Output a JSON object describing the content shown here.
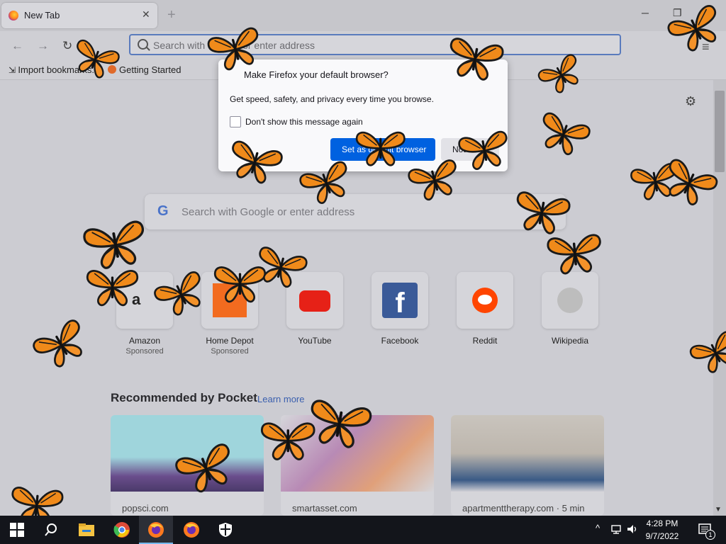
{
  "window": {
    "tab_title": "New Tab",
    "tab_close": "✕",
    "new_tab": "+",
    "minimize": "─",
    "restore": "❐",
    "close": "✕"
  },
  "navbar": {
    "back": "←",
    "forward": "→",
    "reload": "↻",
    "url_placeholder": "Search with Google or enter address",
    "menu": "≡"
  },
  "bookmarks": [
    {
      "label": "Import bookmarks..."
    },
    {
      "label": "Getting Started"
    }
  ],
  "dialog": {
    "title": "Make Firefox your default browser?",
    "subtitle": "Get speed, safety, and privacy every time you browse.",
    "checkbox_label": "Don't show this message again",
    "primary_button": "Set as default browser",
    "secondary_button": "Not now"
  },
  "newtab": {
    "search_placeholder": "Search with Google or enter address",
    "google_logo": "G",
    "settings_icon": "⚙",
    "tiles": [
      {
        "label": "Amazon",
        "sub": "Sponsored",
        "icon": "amazon-icon"
      },
      {
        "label": "Home Depot",
        "sub": "Sponsored",
        "icon": "home-depot-icon"
      },
      {
        "label": "YouTube",
        "sub": "",
        "icon": "youtube-icon"
      },
      {
        "label": "Facebook",
        "sub": "",
        "icon": "facebook-icon"
      },
      {
        "label": "Reddit",
        "sub": "",
        "icon": "reddit-icon"
      },
      {
        "label": "Wikipedia",
        "sub": "",
        "icon": "wikipedia-icon"
      }
    ],
    "pocket_title": "Recommended by Pocket",
    "learn_more": "Learn more",
    "cards": [
      {
        "source": "popsci.com"
      },
      {
        "source": "smartasset.com"
      },
      {
        "source": "apartmenttherapy.com · 5 min"
      }
    ]
  },
  "taskbar": {
    "time": "4:28 PM",
    "date": "9/7/2022",
    "notification_count": "1",
    "tray_chevron": "^",
    "apps": [
      "start-icon",
      "search-icon",
      "file-explorer-icon",
      "chrome-icon",
      "firefox-icon",
      "firefox-icon",
      "security-icon"
    ]
  },
  "colors": {
    "accent": "#0061e0",
    "butterfly_orange": "#f08a1a"
  }
}
